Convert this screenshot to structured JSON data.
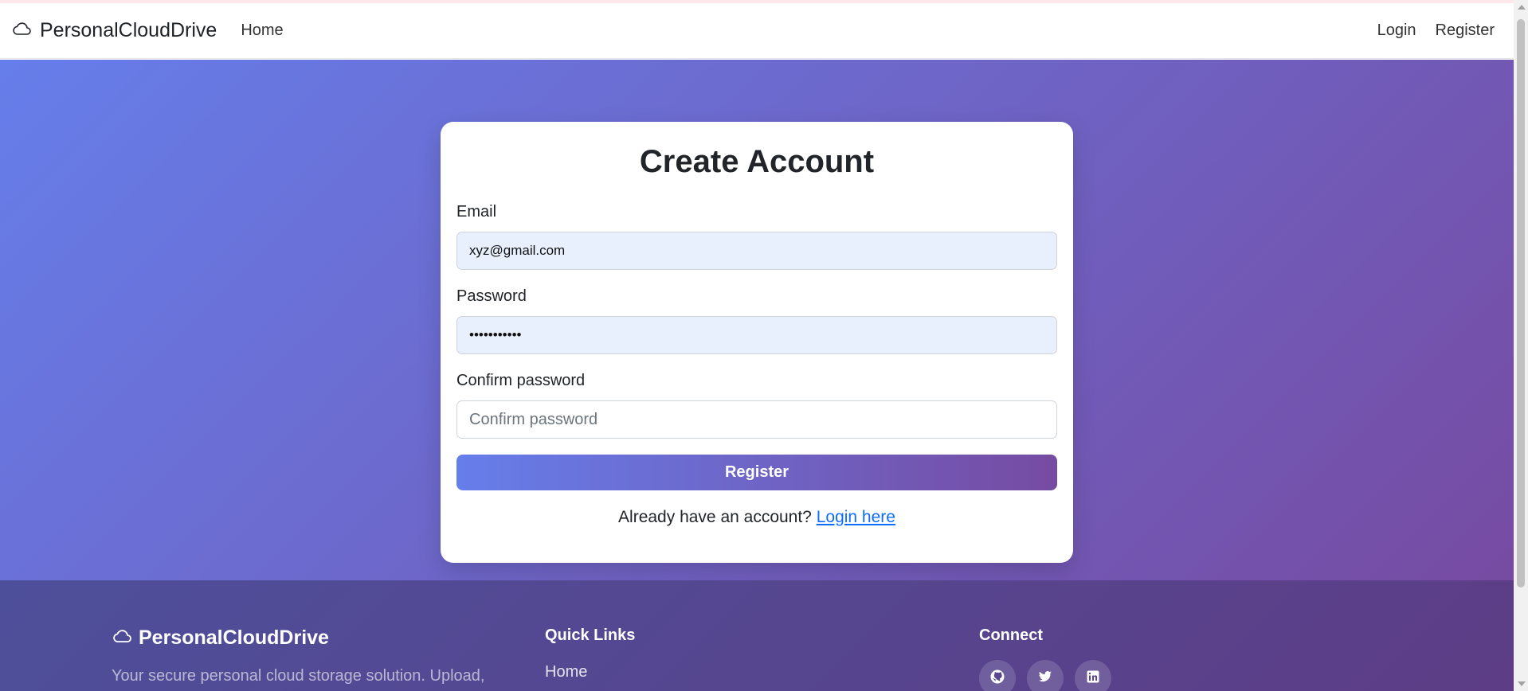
{
  "navbar": {
    "brand": "PersonalCloudDrive",
    "brand_icon": "cloud-icon",
    "home": "Home",
    "login": "Login",
    "register": "Register"
  },
  "form": {
    "title": "Create Account",
    "email_label": "Email",
    "email_value": "xyz@gmail.com",
    "password_label": "Password",
    "password_value": "•••••••••••",
    "confirm_label": "Confirm password",
    "confirm_placeholder": "Confirm password",
    "submit": "Register",
    "login_prompt": "Already have an account?",
    "login_link": "Login here"
  },
  "footer": {
    "brand": "PersonalCloudDrive",
    "description": "Your secure personal cloud storage solution. Upload,",
    "quick_links_title": "Quick Links",
    "quick_links": [
      "Home"
    ],
    "connect_title": "Connect",
    "social_icons": [
      "github-icon",
      "twitter-icon",
      "linkedin-icon"
    ]
  },
  "colors": {
    "gradient_start": "#667eea",
    "gradient_end": "#764ba2",
    "link": "#0d6efd",
    "autofill_bg": "#e8f0fe"
  }
}
